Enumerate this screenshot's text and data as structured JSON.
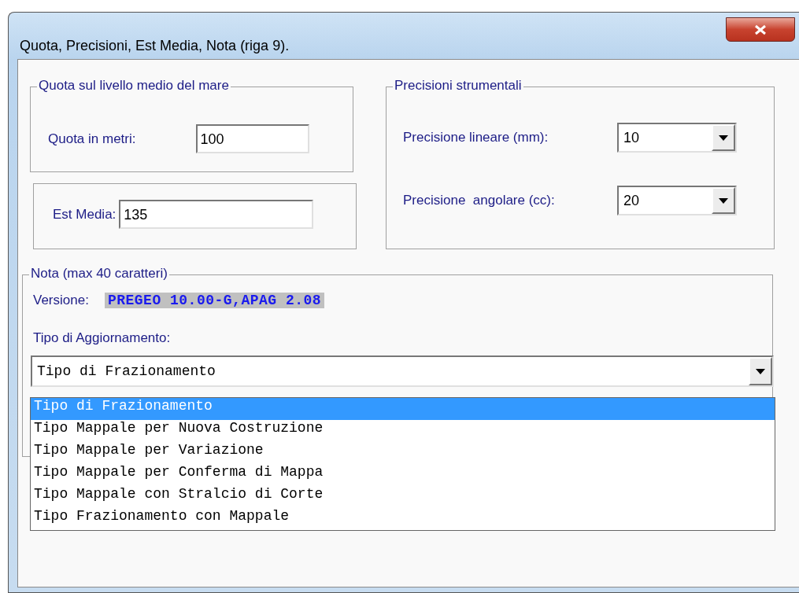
{
  "window": {
    "title": "Quota, Precisioni, Est Media, Nota  (riga 9)."
  },
  "elevation_group": {
    "legend": "Quota sul livello medio del mare",
    "label": "Quota in metri:",
    "value": "100"
  },
  "est_media": {
    "label": "Est Media:",
    "value": "135"
  },
  "precision_group": {
    "legend": "Precisioni strumentali",
    "fields": [
      {
        "label": "Precisione lineare (mm):",
        "value": "10"
      },
      {
        "label": "Precisione  angolare (cc):",
        "value": "20"
      }
    ]
  },
  "note_group": {
    "legend": "Nota (max 40 caratteri)",
    "version_label": "Versione:",
    "version_value": "PREGEO 10.00-G,APAG 2.08",
    "type_label": "Tipo di Aggiornamento:",
    "type_value": "Tipo di Frazionamento",
    "options": [
      {
        "label": "Tipo di Frazionamento",
        "selected": true
      },
      {
        "label": "Tipo Mappale per Nuova Costruzione",
        "selected": false
      },
      {
        "label": "Tipo Mappale per Variazione",
        "selected": false
      },
      {
        "label": "Tipo Mappale per Conferma di Mappa",
        "selected": false
      },
      {
        "label": "Tipo Mappale con Stralcio di Corte",
        "selected": false
      },
      {
        "label": "Tipo Frazionamento con Mappale",
        "selected": false
      }
    ]
  }
}
